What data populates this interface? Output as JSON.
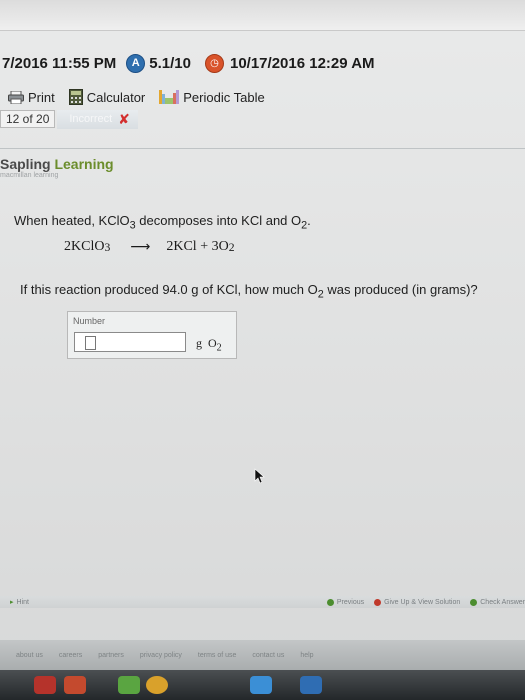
{
  "status": {
    "due_date": "7/2016 11:55 PM",
    "score": "5.1/10",
    "late_date": "10/17/2016 12:29 AM"
  },
  "toolbar": {
    "print": "Print",
    "calculator": "Calculator",
    "periodic_table": "Periodic Table"
  },
  "question_nav": {
    "position": "12 of 20",
    "result": "Incorrect"
  },
  "brand": {
    "logo_part1": "Sapling ",
    "logo_part2": "Learning",
    "tagline": "macmillan learning"
  },
  "question": {
    "intro_before": "When heated, KClO",
    "intro_sub1": "3",
    "intro_middle": " decomposes into KCl and O",
    "intro_sub2": "2",
    "intro_after": ".",
    "eq_left": "2KClO",
    "eq_left_sub": "3",
    "eq_arrow": "⟶",
    "eq_right1": "2KCl + 3O",
    "eq_right_sub": "2",
    "prompt_before": "If this reaction produced 94.0 g of KCl, how much O",
    "prompt_sub": "2",
    "prompt_after": " was produced (in grams)?"
  },
  "answer": {
    "label": "Number",
    "value": "",
    "unit_g": "g",
    "unit_o": "O",
    "unit_sub": "2"
  },
  "bottom": {
    "hint": "Hint",
    "previous": "Previous",
    "give_up": "Give Up & View Solution",
    "check": "Check Answer"
  },
  "footer": {
    "links": [
      "about us",
      "careers",
      "partners",
      "privacy policy",
      "terms of use",
      "contact us",
      "help"
    ]
  }
}
